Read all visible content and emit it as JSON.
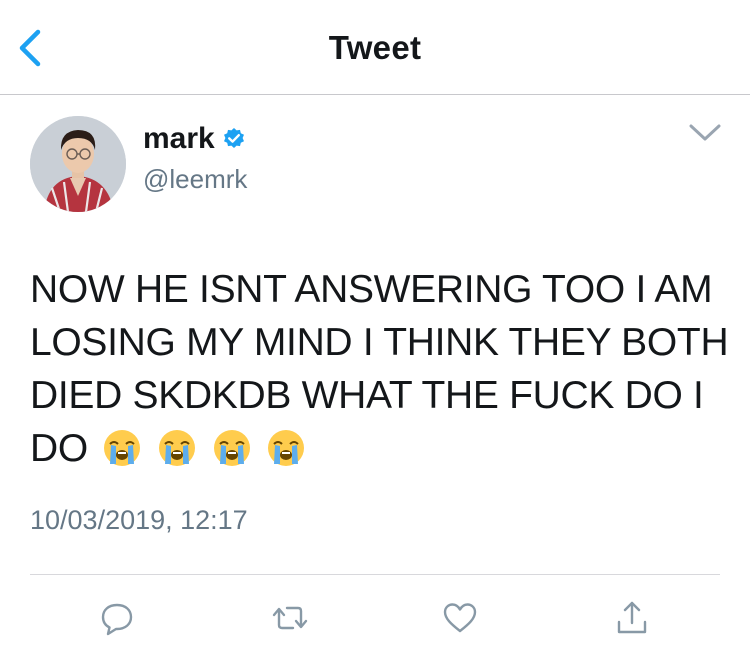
{
  "header": {
    "title": "Tweet",
    "back_icon": "chevron-left-icon"
  },
  "tweet": {
    "author_name": "mark",
    "author_handle": "@leemrk",
    "verified": true,
    "text": "NOW HE ISNT ANSWERING TOO I AM LOSING MY MIND I THINK THEY BOTH DIED SKDKDB WHAT THE FUCK DO I DO",
    "emoji": [
      "loudly-crying-face",
      "loudly-crying-face",
      "loudly-crying-face",
      "loudly-crying-face"
    ],
    "timestamp": "10/03/2019, 12:17"
  },
  "actions": [
    "reply-icon",
    "retweet-icon",
    "like-icon",
    "share-icon"
  ],
  "colors": {
    "accent": "#1da1f2",
    "secondary_text": "#657786",
    "icon_gray": "#8899a6"
  }
}
